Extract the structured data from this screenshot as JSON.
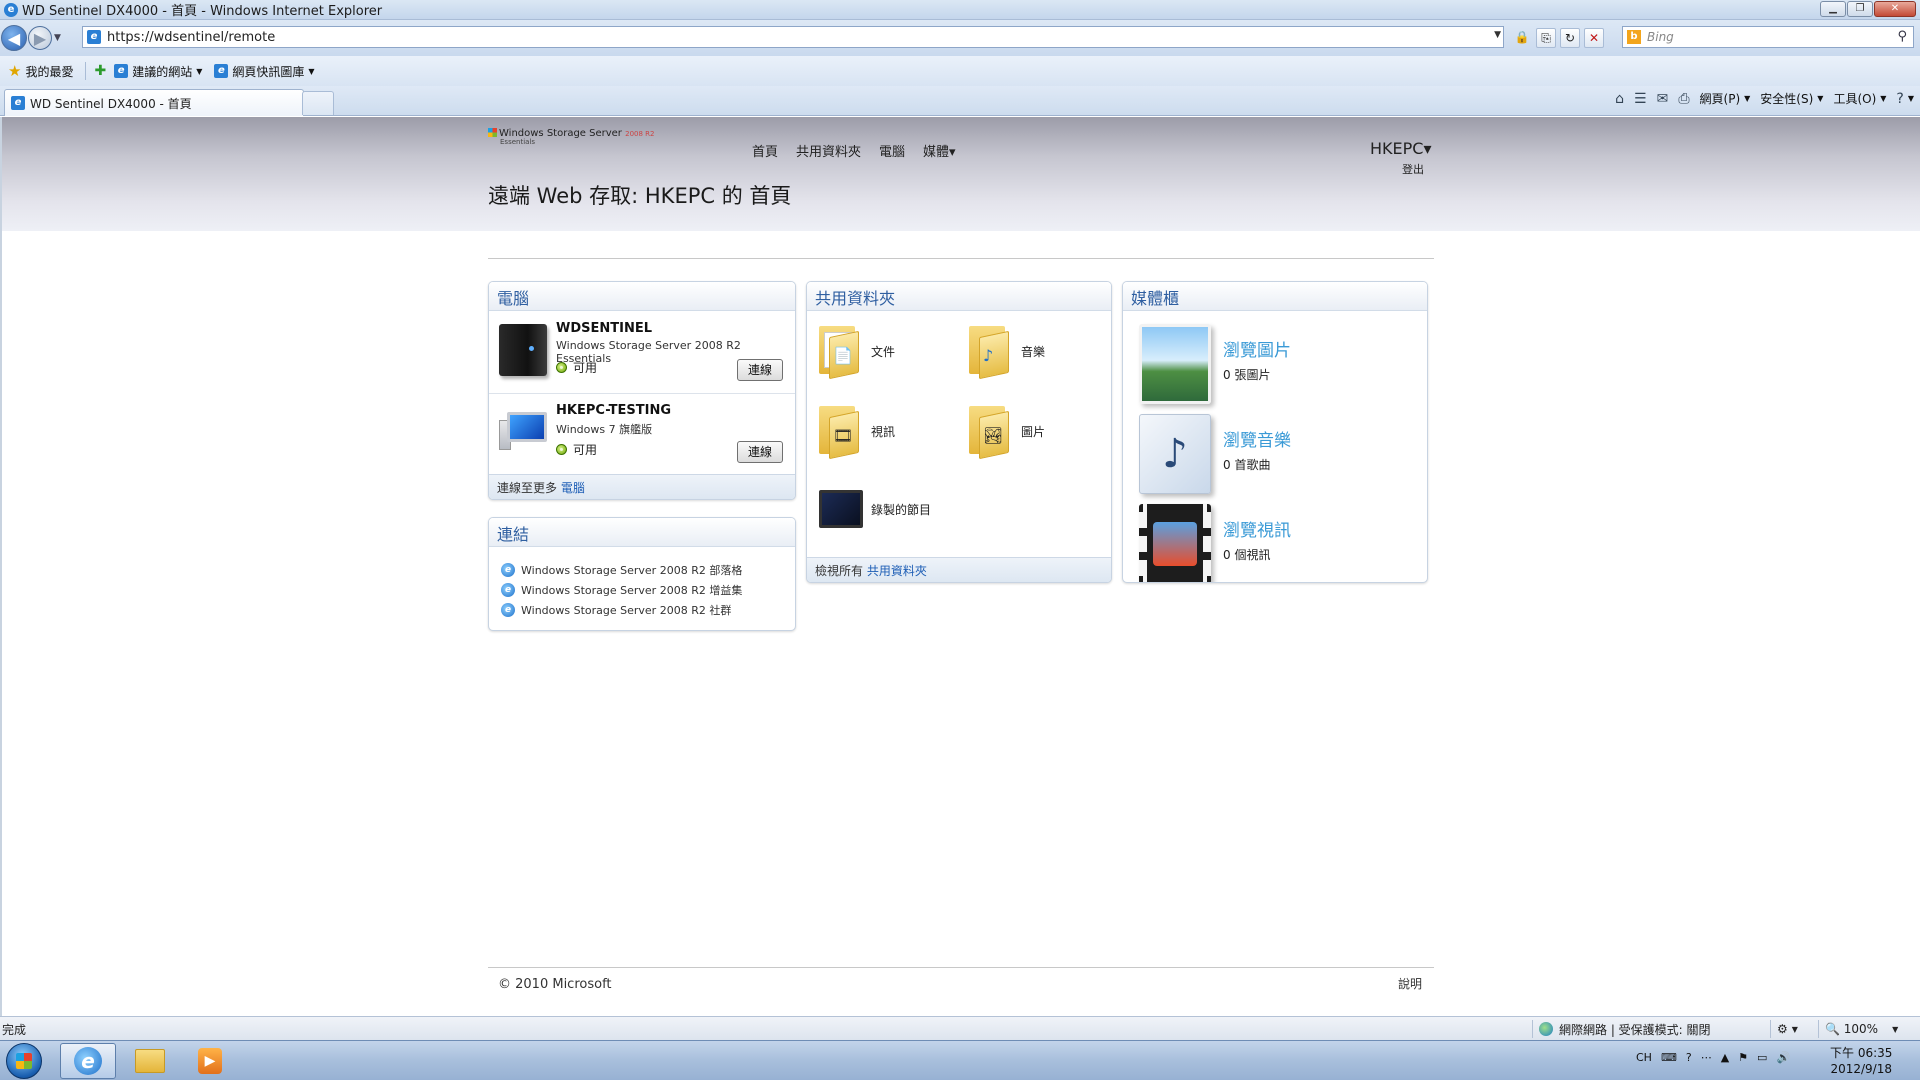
{
  "window": {
    "title": "WD Sentinel DX4000 - 首頁 - Windows Internet Explorer",
    "app_icon": "e",
    "min": "▁",
    "max": "❐",
    "close": "✕"
  },
  "addressbar": {
    "url": "https://wdsentinel/remote",
    "search_placeholder": "Bing",
    "search_icon": "⚲",
    "back_glyph": "◀",
    "forward_glyph": "▶",
    "dropdown": "▼",
    "lock_glyph": "🔒",
    "compat_glyph": "⎘",
    "refresh_glyph": "↻",
    "stop_glyph": "✕"
  },
  "favbar": {
    "favorites": "我的最愛",
    "suggested_sites": "建議的網站",
    "web_slice": "網頁快訊圖庫",
    "star": "★",
    "add": "✚"
  },
  "tabs": [
    {
      "label": "WD Sentinel DX4000 - 首頁"
    }
  ],
  "commandbar": {
    "home": "⌂",
    "feeds": "☰",
    "mail": "✉",
    "print": "⎙",
    "page": "網頁(P)",
    "safety": "安全性(S)",
    "tools": "工具(O)",
    "help": "?"
  },
  "site": {
    "logo_text": "Windows Storage Server",
    "logo_version": "2008 R2",
    "logo_sub": "Essentials",
    "nav": [
      "首頁",
      "共用資料夾",
      "電腦",
      "媒體▾"
    ],
    "user": "HKEPC▾",
    "signout": "登出",
    "page_title": "遠端 Web 存取: HKEPC 的 首頁"
  },
  "computers": {
    "heading": "電腦",
    "items": [
      {
        "name": "WDSENTINEL",
        "os": "Windows Storage Server 2008 R2 Essentials",
        "status": "可用",
        "action": "連線"
      },
      {
        "name": "HKEPC-TESTING",
        "os": "Windows 7 旗艦版",
        "status": "可用",
        "action": "連線"
      }
    ],
    "footer_text": "連線至更多",
    "footer_link": "電腦"
  },
  "links": {
    "heading": "連結",
    "items": [
      "Windows Storage Server 2008 R2 部落格",
      "Windows Storage Server 2008 R2 增益集",
      "Windows Storage Server 2008 R2 社群"
    ]
  },
  "shared_folders": {
    "heading": "共用資料夾",
    "items": [
      {
        "label": "文件",
        "icon": "documents-folder-icon",
        "emblem": "📄"
      },
      {
        "label": "音樂",
        "icon": "music-folder-icon",
        "emblem": "♪"
      },
      {
        "label": "視訊",
        "icon": "video-folder-icon",
        "emblem": "🎞"
      },
      {
        "label": "圖片",
        "icon": "pictures-folder-icon",
        "emblem": "🏞"
      },
      {
        "label": "錄製的節目",
        "icon": "recorded-tv-icon"
      }
    ],
    "footer_text": "檢視所有",
    "footer_link": "共用資料夾"
  },
  "media": {
    "heading": "媒體櫃",
    "items": [
      {
        "title": "瀏覽圖片",
        "count": "0 張圖片"
      },
      {
        "title": "瀏覽音樂",
        "count": "0 首歌曲"
      },
      {
        "title": "瀏覽視訊",
        "count": "0 個視訊"
      }
    ],
    "music_glyph": "♪"
  },
  "footer": {
    "copyright": "© 2010 Microsoft",
    "help": "說明"
  },
  "statusbar": {
    "status": "完成",
    "zone": "網際網路 | 受保護模式: 關閉",
    "zoom": "100%",
    "zoom_icon": "🔍",
    "security_icon": "⚙"
  },
  "taskbar": {
    "tray": [
      "CH",
      "⌨",
      "?",
      "⋯",
      "▲",
      "⚑",
      "▭",
      "🔊"
    ],
    "time": "下午 06:35",
    "date": "2012/9/18",
    "media_glyph": "▶",
    "ie_glyph": "e"
  }
}
